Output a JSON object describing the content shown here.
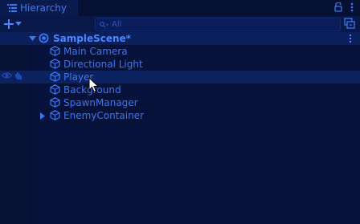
{
  "window": {
    "tab_title": "Hierarchy",
    "tab_icon": "list-icon",
    "lock_icon": "lock-icon",
    "menu_icon": "kebab-menu-icon"
  },
  "toolbar": {
    "add_icon": "plus-icon",
    "dropdown_icon": "chevron-down-icon",
    "search": {
      "placeholder": "All",
      "value": "",
      "icon": "search-icon"
    },
    "scene_visibility_icon": "scene-visibility-icon"
  },
  "hierarchy": {
    "scene": {
      "name": "SampleScene*",
      "expanded": true,
      "icon": "unity-scene-icon"
    },
    "objects": [
      {
        "name": "Main Camera",
        "has_children": false,
        "icon": "gameobject-cube-icon"
      },
      {
        "name": "Directional Light",
        "has_children": false,
        "icon": "gameobject-cube-icon"
      },
      {
        "name": "Player",
        "has_children": false,
        "icon": "gameobject-cube-icon",
        "hovered": true
      },
      {
        "name": "Background",
        "has_children": false,
        "icon": "gameobject-cube-icon"
      },
      {
        "name": "SpawnManager",
        "has_children": false,
        "icon": "gameobject-cube-icon"
      },
      {
        "name": "EnemyContainer",
        "has_children": true,
        "expanded": false,
        "icon": "gameobject-cube-icon"
      }
    ]
  },
  "colors": {
    "background": "#06123a",
    "text": "#3a76f0",
    "accent": "#4a86ff"
  }
}
